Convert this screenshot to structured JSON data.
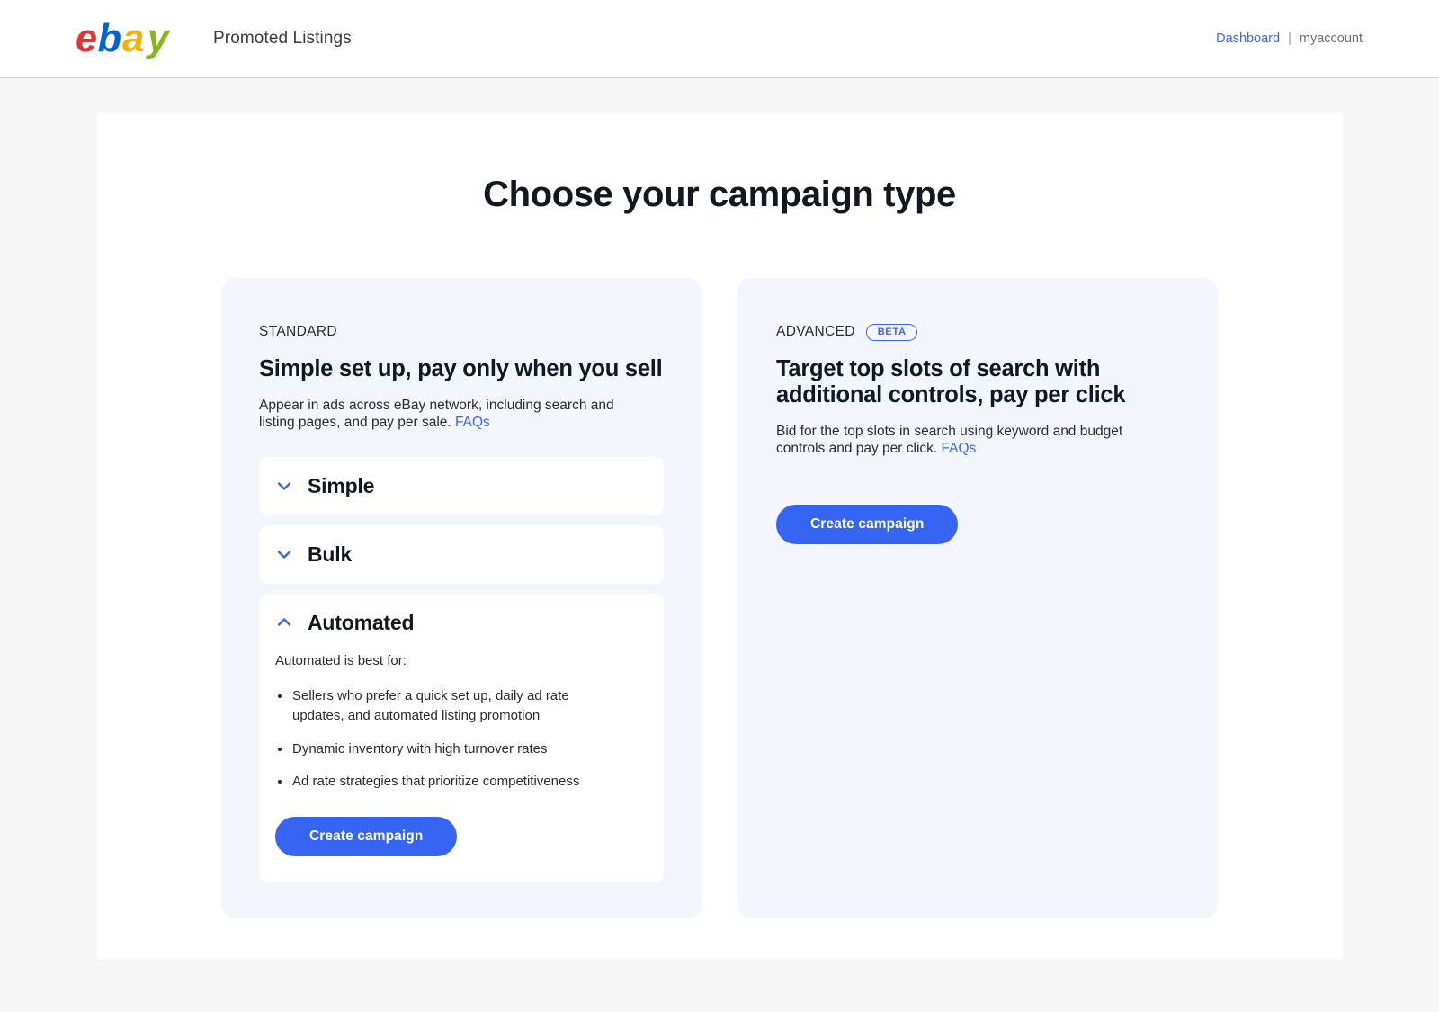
{
  "header": {
    "logo_alt": "ebay",
    "app_name": "Promoted Listings",
    "dashboard_label": "Dashboard",
    "separator": "|",
    "account_label": "myaccount"
  },
  "main": {
    "title": "Choose your campaign type"
  },
  "standard_card": {
    "eyebrow": "STANDARD",
    "heading": "Simple set up, pay only when you sell",
    "description": "Appear in ads across eBay network, including search and listing pages, and pay per sale.",
    "faqs_label": "FAQs",
    "accordions": [
      {
        "label": "Simple",
        "state": "collapsed",
        "icon": "chevron-down-icon"
      },
      {
        "label": "Bulk",
        "state": "collapsed",
        "icon": "chevron-down-icon"
      },
      {
        "label": "Automated",
        "state": "expanded",
        "icon": "chevron-up-icon",
        "lead": "Automated is best for:",
        "bullets": [
          "Sellers who prefer a quick set up, daily ad rate updates, and automated listing promotion",
          "Dynamic inventory with high turnover rates",
          "Ad rate strategies that prioritize competitiveness"
        ],
        "cta_label": "Create campaign"
      }
    ]
  },
  "advanced_card": {
    "eyebrow": "ADVANCED",
    "badge": "BETA",
    "heading": "Target top slots of search with additional controls, pay per click",
    "description": "Bid for the top slots in search using keyword and budget controls and pay per click.",
    "faqs_label": "FAQs",
    "cta_label": "Create campaign"
  },
  "colors": {
    "accent_blue": "#3665f3",
    "card_bg": "#f4f6fd",
    "page_bg": "#f7f7f7",
    "ebay_red": "#e53238",
    "ebay_blue": "#0064d2",
    "ebay_yellow": "#f5af02",
    "ebay_green": "#86b817"
  }
}
